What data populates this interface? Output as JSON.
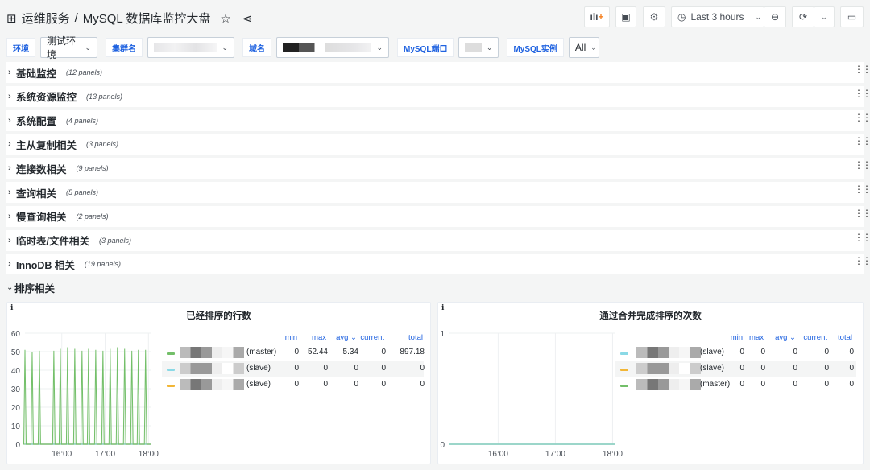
{
  "header": {
    "breadcrumb_folder": "运维服务",
    "separator": "/",
    "dashboard_title": "MySQL 数据库监控大盘",
    "time_range": "Last 3 hours",
    "icons": [
      "apps-grid-icon",
      "star-icon",
      "share-icon",
      "add-panel-icon",
      "save-icon",
      "gear-icon",
      "clock-icon",
      "zoom-out-icon",
      "refresh-icon",
      "chevron-down-icon",
      "tv-mode-icon"
    ]
  },
  "variables": [
    {
      "label": "环境",
      "value": "测试环境"
    },
    {
      "label": "集群名",
      "value": ""
    },
    {
      "label": "域名",
      "value": ""
    },
    {
      "label": "MySQL端口",
      "value": ""
    },
    {
      "label": "MySQL实例",
      "value": "All"
    }
  ],
  "rows": [
    {
      "title": "基础监控",
      "count": "(12 panels)"
    },
    {
      "title": "系统资源监控",
      "count": "(13 panels)"
    },
    {
      "title": "系统配置",
      "count": "(4 panels)"
    },
    {
      "title": "主从复制相关",
      "count": "(3 panels)"
    },
    {
      "title": "连接数相关",
      "count": "(9 panels)"
    },
    {
      "title": "查询相关",
      "count": "(5 panels)"
    },
    {
      "title": "慢查询相关",
      "count": "(2 panels)"
    },
    {
      "title": "临时表/文件相关",
      "count": "(3 panels)"
    },
    {
      "title": "InnoDB 相关",
      "count": "(19 panels)"
    }
  ],
  "expanded_section": {
    "title": "排序相关"
  },
  "legend_headers": {
    "min": "min",
    "max": "max",
    "avg": "avg",
    "current": "current",
    "total": "total"
  },
  "colors": {
    "green": "#73bf69",
    "cyan": "#8ad9e6",
    "yellow": "#f2b636",
    "link": "#1f62e0"
  },
  "chart_data": [
    {
      "type": "line",
      "title": "已经排序的行数",
      "info_icon": "i",
      "ylim": [
        0,
        60
      ],
      "yticks": [
        0,
        10,
        20,
        30,
        40,
        50,
        60
      ],
      "xticks": [
        "16:00",
        "17:00",
        "18:00"
      ],
      "xrange": [
        "15:09",
        "18:03"
      ],
      "grid": true,
      "series": [
        {
          "name": "(master)",
          "color": "#73bf69",
          "spikes": {
            "times": [
              "15:09",
              "15:19",
              "15:29",
              "15:49",
              "15:58",
              "16:08",
              "16:18",
              "16:28",
              "16:37",
              "16:47",
              "16:57",
              "17:07",
              "17:17",
              "17:27",
              "17:37",
              "17:46",
              "17:56"
            ],
            "values": [
              51,
              50,
              50.5,
              50.5,
              51.5,
              52.4,
              51.5,
              50.5,
              51.5,
              51,
              50.5,
              51.5,
              52.4,
              51.5,
              50.5,
              51,
              51
            ]
          },
          "stats": {
            "min": "0",
            "max": "52.44",
            "avg": "5.34",
            "current": "0",
            "total": "897.18"
          }
        },
        {
          "name": "(slave)",
          "color": "#8ad9e6",
          "constant": 0,
          "stats": {
            "min": "0",
            "max": "0",
            "avg": "0",
            "current": "0",
            "total": "0"
          }
        },
        {
          "name": "(slave)",
          "color": "#f2b636",
          "constant": 0,
          "stats": {
            "min": "0",
            "max": "0",
            "avg": "0",
            "current": "0",
            "total": "0"
          }
        }
      ]
    },
    {
      "type": "line",
      "title": "通过合并完成排序的次数",
      "info_icon": "i",
      "ylim": [
        0,
        1
      ],
      "yticks": [
        0,
        1
      ],
      "xticks": [
        "16:00",
        "17:00",
        "18:00"
      ],
      "xrange": [
        "15:09",
        "18:03"
      ],
      "grid": true,
      "series": [
        {
          "name": "(slave)",
          "color": "#8ad9e6",
          "constant": 0,
          "stats": {
            "min": "0",
            "max": "0",
            "avg": "0",
            "current": "0",
            "total": "0"
          }
        },
        {
          "name": "(slave)",
          "color": "#f2b636",
          "constant": 0,
          "stats": {
            "min": "0",
            "max": "0",
            "avg": "0",
            "current": "0",
            "total": "0"
          }
        },
        {
          "name": "(master)",
          "color": "#73bf69",
          "constant": 0,
          "stats": {
            "min": "0",
            "max": "0",
            "avg": "0",
            "current": "0",
            "total": "0"
          }
        }
      ]
    }
  ]
}
